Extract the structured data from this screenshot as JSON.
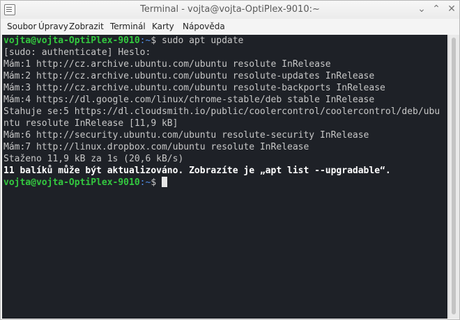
{
  "window": {
    "title": "Terminal - vojta@vojta-OptiPlex-9010:~"
  },
  "menu": [
    "Soubor",
    "Úpravy",
    "Zobrazit",
    "Terminál",
    "Karty",
    "Nápověda"
  ],
  "prompt": {
    "user_host": "vojta@vojta-OptiPlex-9010",
    "path": ":~",
    "symbol": "$"
  },
  "command": " sudo apt update",
  "output": [
    "[sudo: authenticate] Heslo:",
    "Mám:1 http://cz.archive.ubuntu.com/ubuntu resolute InRelease",
    "Mám:2 http://cz.archive.ubuntu.com/ubuntu resolute-updates InRelease",
    "Mám:3 http://cz.archive.ubuntu.com/ubuntu resolute-backports InRelease",
    "Mám:4 https://dl.google.com/linux/chrome-stable/deb stable InRelease",
    "Stahuje se:5 https://dl.cloudsmith.io/public/coolercontrol/coolercontrol/deb/ubu",
    "ntu resolute InRelease [11,9 kB]",
    "Mám:6 http://security.ubuntu.com/ubuntu resolute-security InRelease",
    "Mám:7 http://linux.dropbox.com/ubuntu resolute InRelease",
    "Staženo 11,9 kB za 1s (20,6 kB/s)",
    "11 balíků může být aktualizováno. Zobrazíte je „apt list --upgradable“."
  ]
}
